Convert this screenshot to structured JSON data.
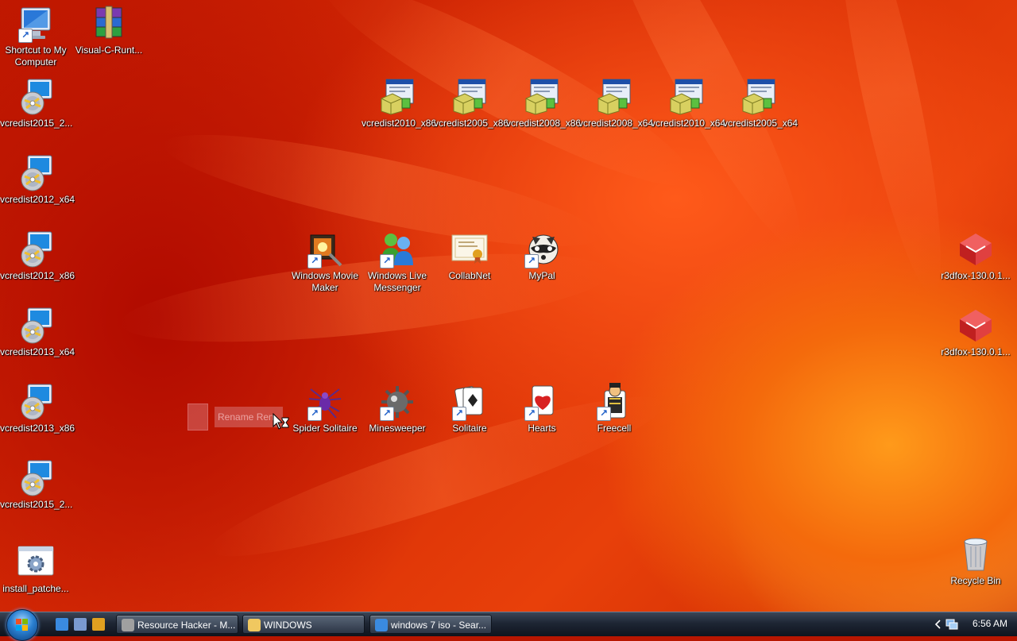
{
  "desktop": {
    "left_column": [
      {
        "name": "shortcut-to-my-computer",
        "label": "Shortcut to My Computer",
        "type": "computer",
        "shortcut": true
      },
      {
        "name": "vcredist2015-2-a",
        "label": "vcredist2015_2...",
        "type": "setup"
      },
      {
        "name": "vcredist2012-x64",
        "label": "vcredist2012_x64",
        "type": "setup"
      },
      {
        "name": "vcredist2012-x86",
        "label": "vcredist2012_x86",
        "type": "setup"
      },
      {
        "name": "vcredist2013-x64",
        "label": "vcredist2013_x64",
        "type": "setup"
      },
      {
        "name": "vcredist2013-x86",
        "label": "vcredist2013_x86",
        "type": "setup"
      },
      {
        "name": "vcredist2015-2-b",
        "label": "vcredist2015_2...",
        "type": "setup"
      },
      {
        "name": "install-patches",
        "label": "install_patche...",
        "type": "gear"
      }
    ],
    "visual_c_runtime": {
      "label": "Visual-C-Runt...",
      "type": "archive"
    },
    "vcredist_row": [
      {
        "name": "vcredist2010-x86",
        "label": "vcredist2010_x86"
      },
      {
        "name": "vcredist2005-x86",
        "label": "vcredist2005_x86"
      },
      {
        "name": "vcredist2008-x86",
        "label": "vcredist2008_x86"
      },
      {
        "name": "vcredist2008-x64",
        "label": "vcredist2008_x64"
      },
      {
        "name": "vcredist2010-x64",
        "label": "vcredist2010_x64"
      },
      {
        "name": "vcredist2005-x64",
        "label": "vcredist2005_x64"
      }
    ],
    "apps_row": [
      {
        "name": "windows-movie-maker",
        "label": "Windows Movie Maker",
        "type": "movie"
      },
      {
        "name": "windows-live-messenger",
        "label": "Windows Live Messenger",
        "type": "messenger"
      },
      {
        "name": "collabnet",
        "label": "CollabNet",
        "type": "certificate"
      },
      {
        "name": "mypal",
        "label": "MyPal",
        "type": "raccoon"
      }
    ],
    "games_row": [
      {
        "name": "spider-solitaire",
        "label": "Spider Solitaire",
        "type": "spider"
      },
      {
        "name": "minesweeper",
        "label": "Minesweeper",
        "type": "mine"
      },
      {
        "name": "solitaire",
        "label": "Solitaire",
        "type": "cards"
      },
      {
        "name": "hearts",
        "label": "Hearts",
        "type": "hearts"
      },
      {
        "name": "freecell",
        "label": "Freecell",
        "type": "freecell"
      }
    ],
    "right_column": [
      {
        "name": "r3dfox-a",
        "label": "r3dfox-130.0.1..."
      },
      {
        "name": "r3dfox-b",
        "label": "r3dfox-130.0.1..."
      }
    ],
    "recycle_bin": {
      "label": "Recycle Bin"
    },
    "drag_ghost_text": "Rename Ren"
  },
  "taskbar": {
    "quick_launch": [
      "internet-explorer-icon",
      "show-desktop-icon",
      "media-player-icon"
    ],
    "buttons": [
      {
        "label": "Resource Hacker - M...",
        "icon": "resource-hacker-icon"
      },
      {
        "label": "WINDOWS",
        "icon": "folder-icon"
      },
      {
        "label": "windows 7 iso - Sear...",
        "icon": "internet-explorer-icon"
      }
    ],
    "clock": "6:56 AM"
  },
  "colors": {
    "wallpaper_base": "#c01800",
    "taskbar": "#1e2634",
    "label_text": "#ffffff"
  }
}
